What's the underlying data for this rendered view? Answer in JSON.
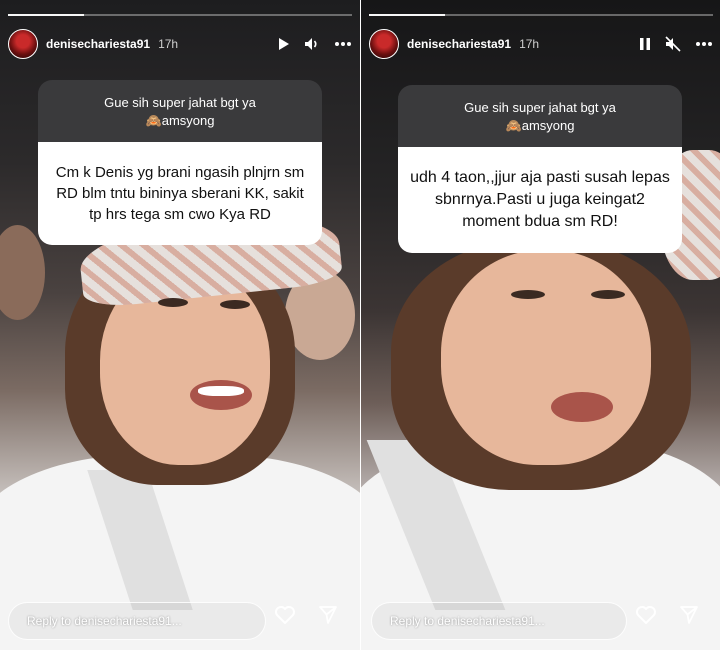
{
  "stories": [
    {
      "username": "denisechariesta91",
      "time": "17h",
      "progress_fraction": 0.22,
      "controls": [
        "play-icon",
        "volume-icon",
        "more-icon"
      ],
      "question": "Gue sih super jahat bgt ya",
      "question_sub": "🙈amsyong",
      "answer": "Cm k Denis yg brani ngasih plnjrn sm RD blm tntu bininya sberani KK, sakit tp hrs tega sm cwo Kya RD",
      "reply_placeholder": "Reply to denisechariesta91...",
      "bottom_icons": [
        "heart-icon",
        "send-icon"
      ]
    },
    {
      "username": "denisechariesta91",
      "time": "17h",
      "progress_fraction": 0.22,
      "controls": [
        "pause-icon",
        "mute-icon",
        "more-icon"
      ],
      "question": "Gue sih super jahat bgt ya",
      "question_sub": "🙈amsyong",
      "answer": "udh 4 taon,,jjur aja pasti susah lepas sbnrnya.Pasti u juga keingat2 moment bdua sm RD!",
      "reply_placeholder": "Reply to denisechariesta91...",
      "bottom_icons": [
        "heart-icon",
        "send-icon"
      ]
    }
  ],
  "colors": {
    "sticker_header": "#3a3a3c",
    "sticker_body": "#ffffff",
    "text_light": "#ffffff"
  }
}
